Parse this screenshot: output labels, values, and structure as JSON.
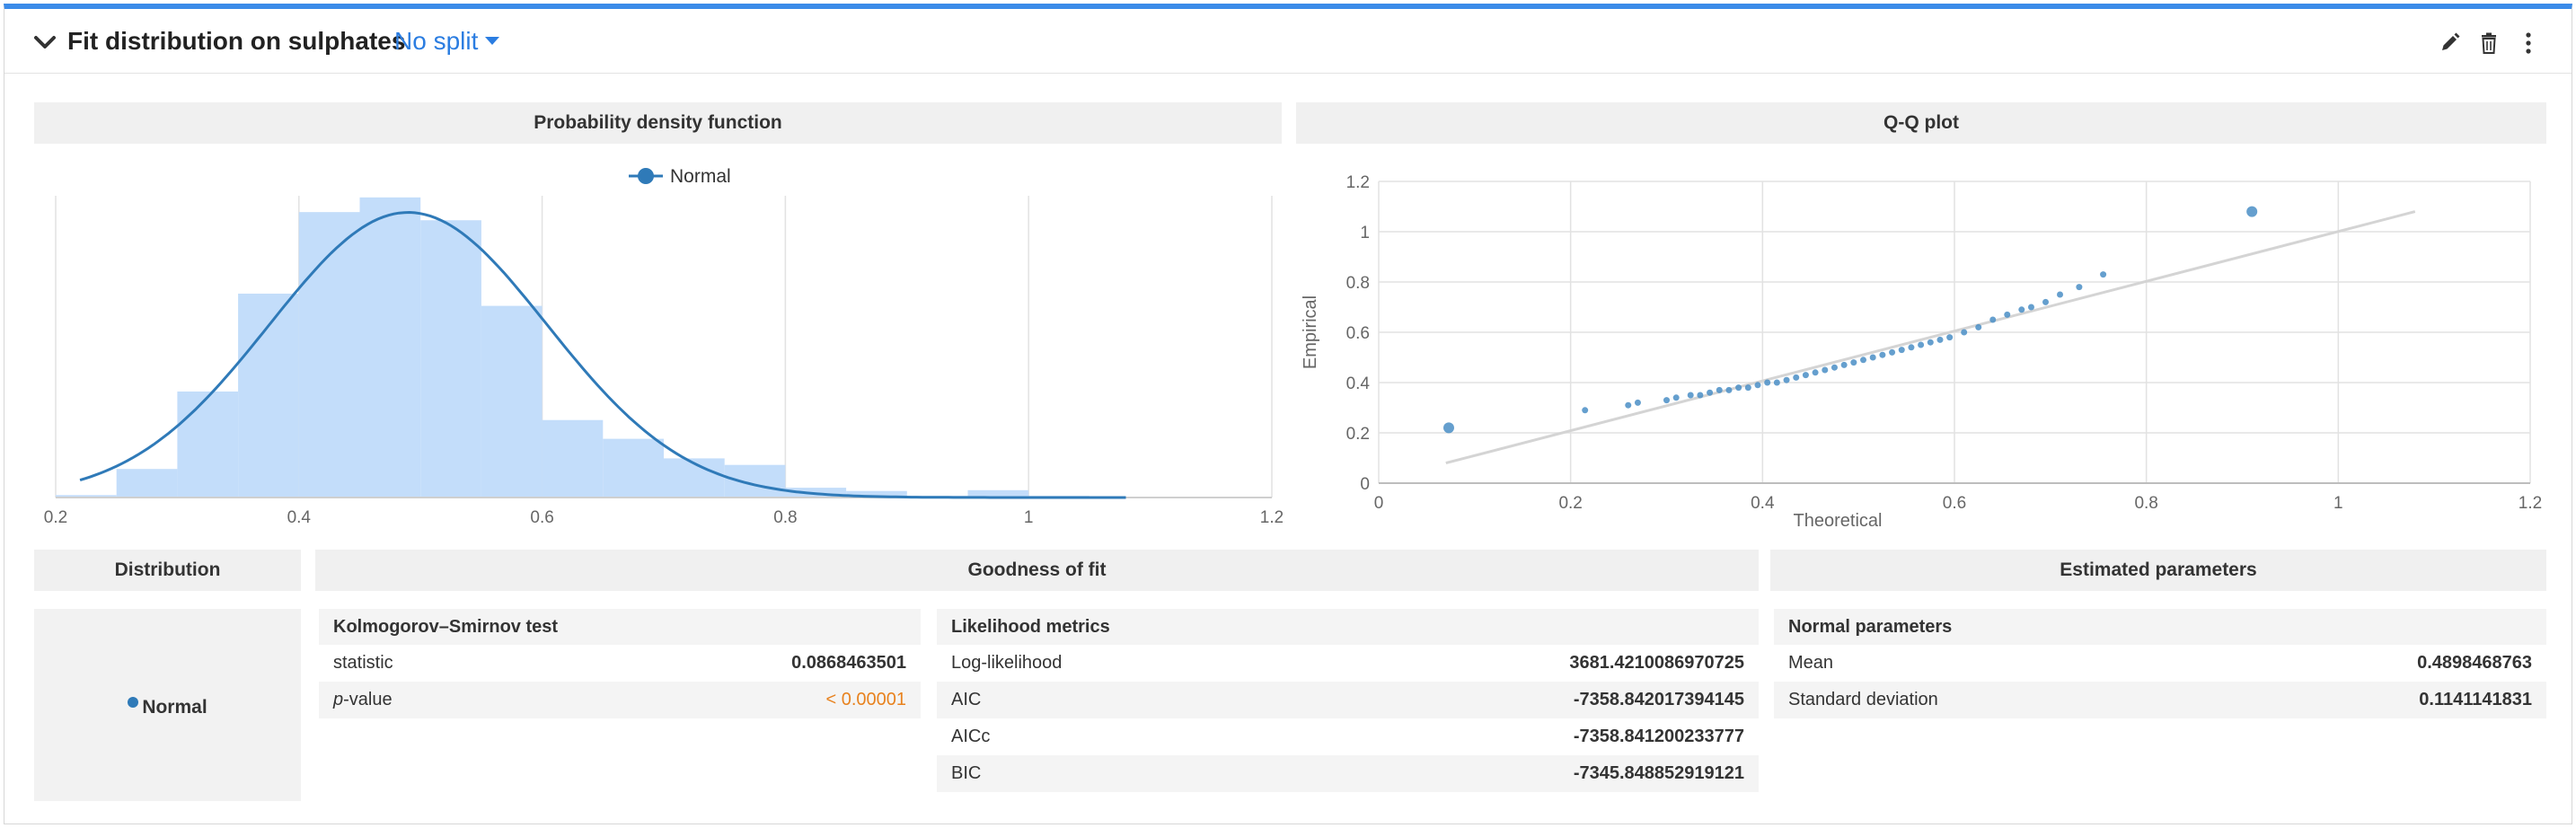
{
  "header": {
    "title": "Fit distribution on sulphates",
    "split_label": "No split"
  },
  "pdf_panel": {
    "title": "Probability density function"
  },
  "qq_panel": {
    "title": "Q-Q plot"
  },
  "distribution_panel": {
    "title": "Distribution",
    "item": "Normal"
  },
  "goodness_panel": {
    "title": "Goodness of fit"
  },
  "estimated_panel": {
    "title": "Estimated parameters"
  },
  "ks_test": {
    "title": "Kolmogorov–Smirnov test",
    "rows": [
      {
        "label": "statistic",
        "value": "0.0868463501"
      },
      {
        "label_italic": "p",
        "label": "-value",
        "value": "< 0.00001"
      }
    ]
  },
  "likelihood": {
    "title": "Likelihood metrics",
    "rows": [
      {
        "label": "Log-likelihood",
        "value": "3681.4210086970725"
      },
      {
        "label": "AIC",
        "value": "-7358.842017394145"
      },
      {
        "label": "AICc",
        "value": "-7358.841200233777"
      },
      {
        "label": "BIC",
        "value": "-7345.848852919121"
      }
    ]
  },
  "normal_params": {
    "title": "Normal parameters",
    "rows": [
      {
        "label": "Mean",
        "value": "0.4898468763"
      },
      {
        "label": "Standard deviation",
        "value": "0.1141141831"
      }
    ]
  },
  "colors": {
    "accent": "#3b8be8",
    "link": "#2b7de1",
    "histogram": "#c3ddfa",
    "curve": "#2f7ab8",
    "warning": "#e8821e"
  },
  "chart_data": [
    {
      "type": "bar",
      "title": "Probability density function",
      "legend": {
        "entries": [
          "Normal"
        ],
        "placement": "top-center"
      },
      "xlim": [
        0.2,
        1.2
      ],
      "ylim": [
        0,
        3.7
      ],
      "x_ticks": [
        "0.2",
        "0.4",
        "0.6",
        "0.8",
        "1",
        "1.2"
      ],
      "bins": [
        {
          "from": 0.2,
          "to": 0.25,
          "value": 0.03
        },
        {
          "from": 0.25,
          "to": 0.3,
          "value": 0.35
        },
        {
          "from": 0.3,
          "to": 0.35,
          "value": 1.3
        },
        {
          "from": 0.35,
          "to": 0.4,
          "value": 2.5
        },
        {
          "from": 0.4,
          "to": 0.45,
          "value": 3.5
        },
        {
          "from": 0.45,
          "to": 0.5,
          "value": 3.68
        },
        {
          "from": 0.5,
          "to": 0.55,
          "value": 3.4
        },
        {
          "from": 0.55,
          "to": 0.6,
          "value": 2.35
        },
        {
          "from": 0.6,
          "to": 0.65,
          "value": 0.95
        },
        {
          "from": 0.65,
          "to": 0.7,
          "value": 0.72
        },
        {
          "from": 0.7,
          "to": 0.75,
          "value": 0.48
        },
        {
          "from": 0.75,
          "to": 0.8,
          "value": 0.4
        },
        {
          "from": 0.8,
          "to": 0.85,
          "value": 0.12
        },
        {
          "from": 0.85,
          "to": 0.9,
          "value": 0.08
        },
        {
          "from": 0.9,
          "to": 0.95,
          "value": 0.02
        },
        {
          "from": 0.95,
          "to": 1.0,
          "value": 0.09
        },
        {
          "from": 1.0,
          "to": 1.05,
          "value": 0.02
        },
        {
          "from": 1.05,
          "to": 1.1,
          "value": 0.01
        }
      ],
      "series": [
        {
          "name": "Normal",
          "kind": "normal_pdf",
          "mean": 0.4898468763,
          "sd": 0.1141141831,
          "x_range": [
            0.22,
            1.08
          ]
        }
      ],
      "grid": "vertical"
    },
    {
      "type": "scatter",
      "title": "Q-Q plot",
      "xlabel": "Theoretical",
      "ylabel": "Empirical",
      "xlim": [
        0,
        1.2
      ],
      "ylim": [
        0,
        1.2
      ],
      "x_ticks": [
        "0",
        "0.2",
        "0.4",
        "0.6",
        "0.8",
        "1",
        "1.2"
      ],
      "y_ticks": [
        "0",
        "0.2",
        "0.4",
        "0.6",
        "0.8",
        "1",
        "1.2"
      ],
      "grid": true,
      "reference_line": {
        "from": [
          0.07,
          0.08
        ],
        "to": [
          1.08,
          1.08
        ]
      },
      "points": [
        {
          "x": 0.073,
          "y": 0.22,
          "big": true
        },
        {
          "x": 0.215,
          "y": 0.29
        },
        {
          "x": 0.26,
          "y": 0.31
        },
        {
          "x": 0.27,
          "y": 0.32
        },
        {
          "x": 0.3,
          "y": 0.33
        },
        {
          "x": 0.31,
          "y": 0.34
        },
        {
          "x": 0.325,
          "y": 0.35
        },
        {
          "x": 0.335,
          "y": 0.35
        },
        {
          "x": 0.345,
          "y": 0.36
        },
        {
          "x": 0.355,
          "y": 0.37
        },
        {
          "x": 0.365,
          "y": 0.37
        },
        {
          "x": 0.375,
          "y": 0.38
        },
        {
          "x": 0.385,
          "y": 0.38
        },
        {
          "x": 0.395,
          "y": 0.39
        },
        {
          "x": 0.405,
          "y": 0.4
        },
        {
          "x": 0.415,
          "y": 0.4
        },
        {
          "x": 0.425,
          "y": 0.41
        },
        {
          "x": 0.435,
          "y": 0.42
        },
        {
          "x": 0.445,
          "y": 0.43
        },
        {
          "x": 0.455,
          "y": 0.44
        },
        {
          "x": 0.465,
          "y": 0.45
        },
        {
          "x": 0.475,
          "y": 0.46
        },
        {
          "x": 0.485,
          "y": 0.47
        },
        {
          "x": 0.495,
          "y": 0.48
        },
        {
          "x": 0.505,
          "y": 0.49
        },
        {
          "x": 0.515,
          "y": 0.5
        },
        {
          "x": 0.525,
          "y": 0.51
        },
        {
          "x": 0.535,
          "y": 0.52
        },
        {
          "x": 0.545,
          "y": 0.53
        },
        {
          "x": 0.555,
          "y": 0.54
        },
        {
          "x": 0.565,
          "y": 0.55
        },
        {
          "x": 0.575,
          "y": 0.56
        },
        {
          "x": 0.585,
          "y": 0.57
        },
        {
          "x": 0.595,
          "y": 0.58
        },
        {
          "x": 0.61,
          "y": 0.6
        },
        {
          "x": 0.625,
          "y": 0.62
        },
        {
          "x": 0.64,
          "y": 0.65
        },
        {
          "x": 0.655,
          "y": 0.67
        },
        {
          "x": 0.67,
          "y": 0.69
        },
        {
          "x": 0.68,
          "y": 0.7
        },
        {
          "x": 0.695,
          "y": 0.72
        },
        {
          "x": 0.71,
          "y": 0.75
        },
        {
          "x": 0.73,
          "y": 0.78
        },
        {
          "x": 0.755,
          "y": 0.83
        },
        {
          "x": 0.91,
          "y": 1.08,
          "big": true
        }
      ]
    }
  ]
}
